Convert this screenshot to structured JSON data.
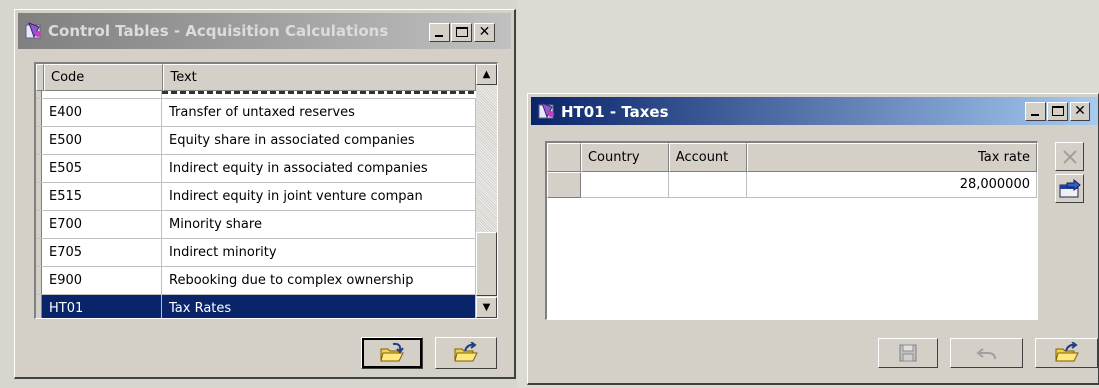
{
  "window_main": {
    "title": "Control Tables - Acquisition Calculations",
    "columns": {
      "code": "Code",
      "text": "Text"
    },
    "rows": [
      {
        "code": "E400",
        "text": "Transfer of untaxed reserves"
      },
      {
        "code": "E500",
        "text": "Equity share in associated companies"
      },
      {
        "code": "E505",
        "text": "Indirect equity in associated companies"
      },
      {
        "code": "E515",
        "text": "Indirect equity in joint venture compan"
      },
      {
        "code": "E700",
        "text": "Minority share"
      },
      {
        "code": "E705",
        "text": "Indirect minority"
      },
      {
        "code": "E900",
        "text": "Rebooking due to complex ownership"
      },
      {
        "code": "HT01",
        "text": "Tax Rates"
      }
    ],
    "selected_row": "HT01",
    "buttons": [
      "open-folder",
      "folder-up"
    ]
  },
  "window_taxes": {
    "title": "HT01 - Taxes",
    "columns": {
      "country": "Country",
      "account": "Account",
      "tax_rate": "Tax rate"
    },
    "rows": [
      {
        "country": "",
        "account": "",
        "tax_rate": "28,000000"
      }
    ],
    "side_buttons": [
      "delete-x",
      "export-arrow"
    ],
    "bottom_buttons": [
      "save-disk",
      "undo",
      "folder-up"
    ]
  },
  "colors": {
    "selection": "#0a246a",
    "active_title": "#0a246a",
    "inactive_title": "#808080",
    "face": "#d4d0c8"
  }
}
